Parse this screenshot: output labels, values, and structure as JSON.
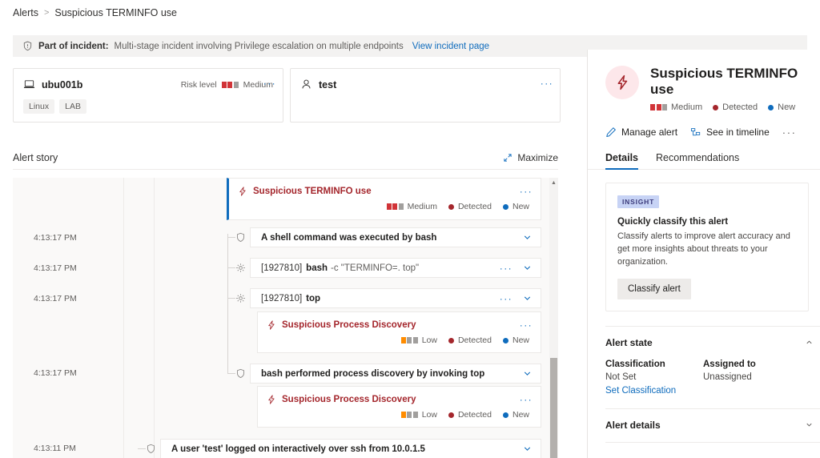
{
  "breadcrumb": {
    "root": "Alerts",
    "separator": ">",
    "current": "Suspicious TERMINFO use"
  },
  "incident_banner": {
    "icon": "shield-icon",
    "label": "Part of incident:",
    "text": "Multi-stage incident involving Privilege escalation on multiple endpoints",
    "link": "View incident page"
  },
  "entity_cards": {
    "device": {
      "icon": "device-icon",
      "name": "ubu001b",
      "risk_label": "Risk level",
      "risk_value": "Medium",
      "risk_squares": [
        "#d13438",
        "#d13438",
        "#a19f9d"
      ],
      "tags": [
        "Linux",
        "LAB"
      ],
      "overflow": "···"
    },
    "user": {
      "icon": "user-icon",
      "name": "test",
      "overflow": "···"
    }
  },
  "alert_story": {
    "title": "Alert story",
    "maximize_label": "Maximize",
    "maximize_icon": "maximize-icon",
    "timestamps": [
      "4:13:17 PM",
      "4:13:17 PM",
      "4:13:17 PM",
      "4:13:17 PM",
      "4:13:11 PM"
    ],
    "primary_alert": {
      "icon": "alert-bolt-icon",
      "title": "Suspicious TERMINFO use",
      "severity": "Medium",
      "severity_squares": [
        "#d13438",
        "#d13438",
        "#a19f9d"
      ],
      "status": "Detected",
      "status_color": "#a4262c",
      "state": "New",
      "state_color": "#0f6cbd",
      "overflow": "···"
    },
    "rows": [
      {
        "icon": "shield-node-icon",
        "text": "A shell command was executed by bash",
        "chevron": "chevron-down-icon"
      },
      {
        "icon": "process-gear-icon",
        "pid": "[1927810]",
        "process": "bash",
        "args": "-c \"TERMINFO=. top\"",
        "overflow": "···",
        "chevron": "chevron-down-icon"
      },
      {
        "icon": "process-gear-icon",
        "pid": "[1927810]",
        "process": "top",
        "args": "",
        "overflow": "···",
        "chevron": "chevron-down-icon"
      },
      {
        "icon": "shield-node-icon",
        "text": "bash performed process discovery by invoking top",
        "chevron": "chevron-down-icon"
      },
      {
        "icon": "shield-node-icon",
        "text": "A user 'test' logged on interactively over ssh from 10.0.1.5",
        "chevron": "chevron-down-icon"
      }
    ],
    "nested_alerts": [
      {
        "icon": "alert-bolt-icon",
        "title": "Suspicious Process Discovery",
        "severity": "Low",
        "severity_squares": [
          "#ff8c00",
          "#a19f9d",
          "#a19f9d"
        ],
        "status": "Detected",
        "status_color": "#a4262c",
        "state": "New",
        "state_color": "#0f6cbd",
        "overflow": "···"
      },
      {
        "icon": "alert-bolt-icon",
        "title": "Suspicious Process Discovery",
        "severity": "Low",
        "severity_squares": [
          "#ff8c00",
          "#a19f9d",
          "#a19f9d"
        ],
        "status": "Detected",
        "status_color": "#a4262c",
        "state": "New",
        "state_color": "#0f6cbd",
        "overflow": "···"
      }
    ],
    "scrollbar": {
      "up_arrow": "scroll-up-icon"
    }
  },
  "details_panel": {
    "icon": "alert-bolt-icon",
    "title": "Suspicious TERMINFO use",
    "severity": "Medium",
    "severity_squares": [
      "#d13438",
      "#d13438",
      "#a19f9d"
    ],
    "status": "Detected",
    "status_color": "#a4262c",
    "state": "New",
    "state_color": "#0f6cbd",
    "actions": {
      "manage": "Manage alert",
      "manage_icon": "pencil-icon",
      "timeline": "See in timeline",
      "timeline_icon": "timeline-icon",
      "overflow": "···"
    },
    "tabs": [
      {
        "label": "Details",
        "active": true
      },
      {
        "label": "Recommendations",
        "active": false
      }
    ],
    "insight": {
      "badge": "INSIGHT",
      "title": "Quickly classify this alert",
      "body": "Classify alerts to improve alert accuracy and get more insights about threats to your organization.",
      "button": "Classify alert"
    },
    "alert_state": {
      "heading": "Alert state",
      "chevron": "chevron-up-icon",
      "classification_label": "Classification",
      "classification_value": "Not Set",
      "classification_link": "Set Classification",
      "assigned_label": "Assigned to",
      "assigned_value": "Unassigned"
    },
    "alert_details": {
      "heading": "Alert details",
      "chevron": "chevron-down-icon"
    }
  }
}
